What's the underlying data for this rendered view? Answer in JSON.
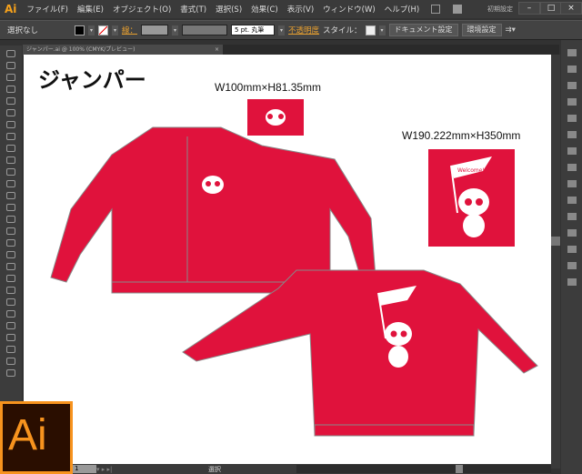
{
  "app": {
    "logo": "Ai",
    "workspace": "初期設定"
  },
  "menu": [
    "ファイル(F)",
    "編集(E)",
    "オブジェクト(O)",
    "書式(T)",
    "選択(S)",
    "効果(C)",
    "表示(V)",
    "ウィンドウ(W)",
    "ヘルプ(H)"
  ],
  "control": {
    "selection": "選択なし",
    "stroke_label": "線：",
    "brush": "5 pt. 丸筆",
    "opacity_label": "不透明度",
    "style_label": "スタイル：",
    "doc_settings": "ドキュメント設定",
    "preferences": "環境設定"
  },
  "tab": {
    "title": "ジャンパー.ai @ 100% (CMYK/プレビュー)",
    "close": "×"
  },
  "artboard": {
    "title": "ジャンパー",
    "front_logo_size": "W100mm×H81.35mm",
    "back_logo_size": "W190.222mm×H350mm",
    "flag_text": "Welcome!",
    "garment_color": "#e0123c"
  },
  "status": {
    "artboard_num": "1",
    "tool": "選択"
  }
}
